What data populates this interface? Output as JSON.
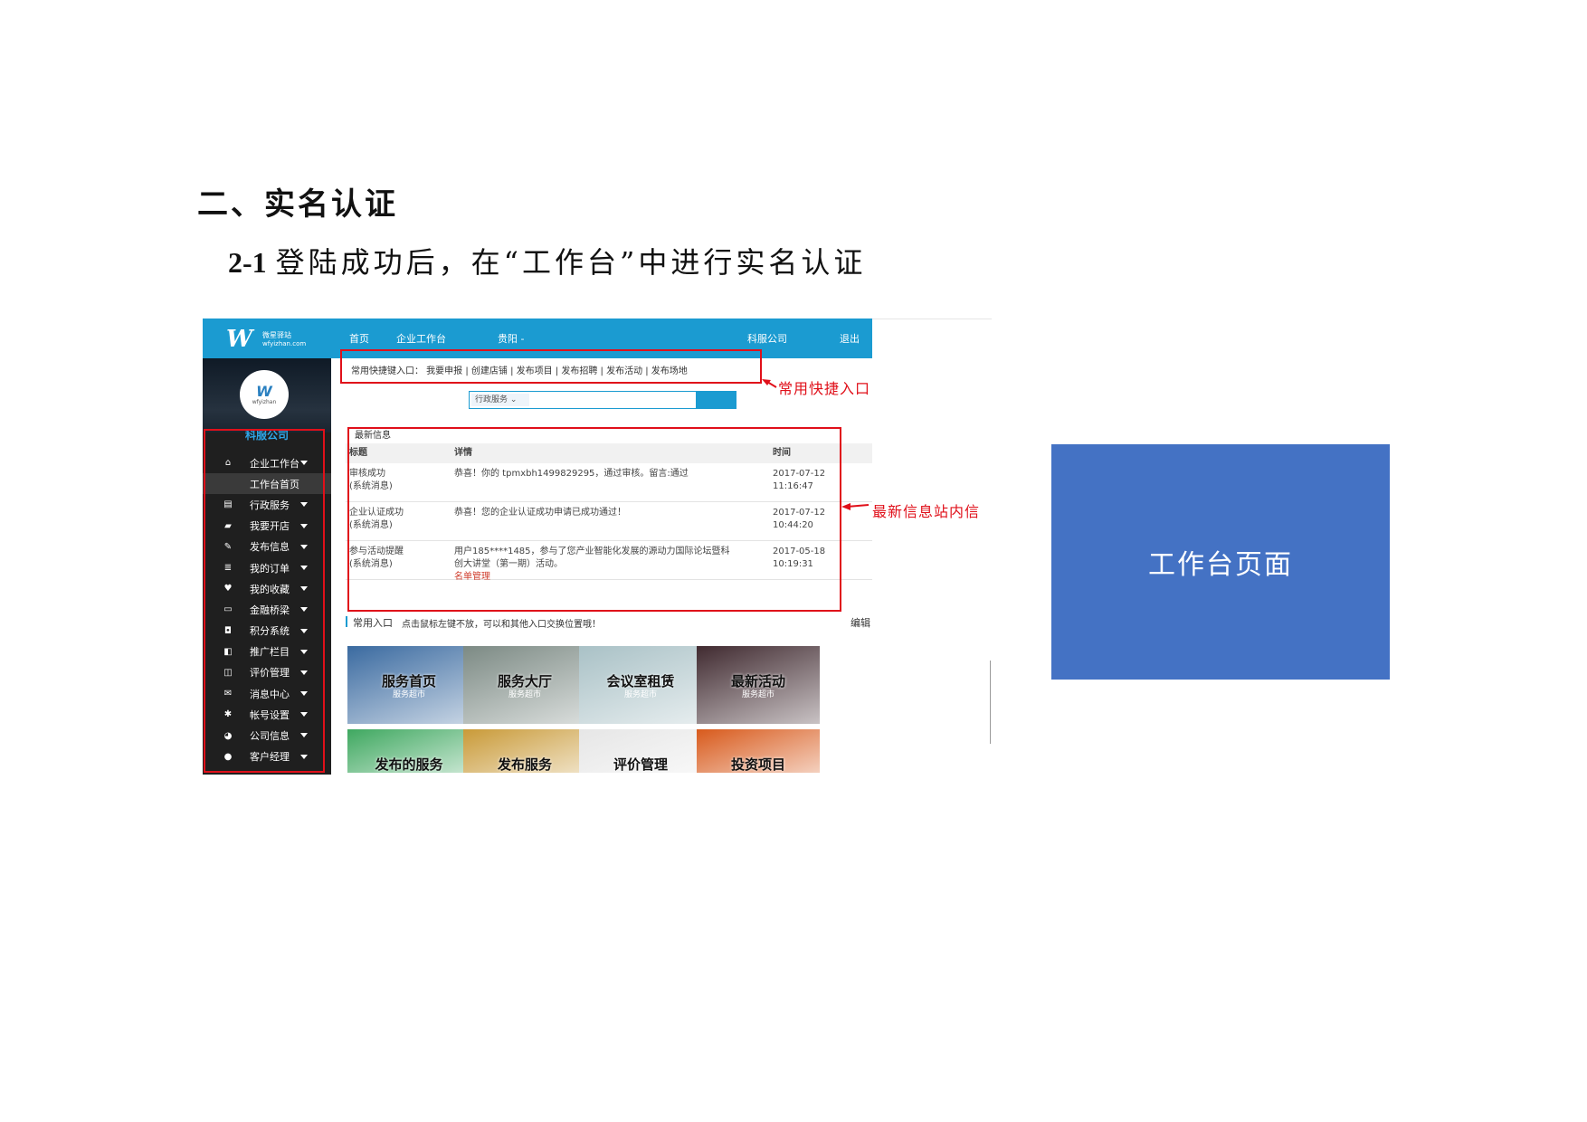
{
  "doc": {
    "heading": "二、实名认证",
    "step_num": "2-1",
    "step_text": "登陆成功后，在“工作台”中进行实名认证"
  },
  "topbar": {
    "logo_mark": "W",
    "logo_sub1": "微星驿站",
    "logo_sub2": "wfyizhan.com",
    "nav": [
      "首页",
      "企业工作台",
      "贵阳 -",
      "科服公司",
      "退出"
    ]
  },
  "sidebar": {
    "avatar_mark": "W",
    "avatar_text": "wfyizhan",
    "company": "科服公司",
    "items": [
      {
        "label": "企业工作台",
        "icon": "home-icon",
        "glyph": "⌂",
        "arrow": true
      },
      {
        "label": "工作台首页",
        "icon": "",
        "glyph": "",
        "arrow": false,
        "sub": true
      },
      {
        "label": "行政服务",
        "icon": "document-icon",
        "glyph": "▤",
        "arrow": true
      },
      {
        "label": "我要开店",
        "icon": "shop-icon",
        "glyph": "▰",
        "arrow": true
      },
      {
        "label": "发布信息",
        "icon": "pencil-icon",
        "glyph": "✎",
        "arrow": true
      },
      {
        "label": "我的订单",
        "icon": "list-icon",
        "glyph": "≣",
        "arrow": true
      },
      {
        "label": "我的收藏",
        "icon": "heart-icon",
        "glyph": "♥",
        "arrow": true
      },
      {
        "label": "金融桥梁",
        "icon": "card-icon",
        "glyph": "▭",
        "arrow": true
      },
      {
        "label": "积分系统",
        "icon": "gift-icon",
        "glyph": "◘",
        "arrow": true
      },
      {
        "label": "推广栏目",
        "icon": "promo-icon",
        "glyph": "◧",
        "arrow": true
      },
      {
        "label": "评价管理",
        "icon": "comment-icon",
        "glyph": "◫",
        "arrow": true
      },
      {
        "label": "消息中心",
        "icon": "mail-icon",
        "glyph": "✉",
        "arrow": true
      },
      {
        "label": "帐号设置",
        "icon": "gear-icon",
        "glyph": "✱",
        "arrow": true
      },
      {
        "label": "公司信息",
        "icon": "pie-icon",
        "glyph": "◕",
        "arrow": true
      },
      {
        "label": "客户经理",
        "icon": "user-icon",
        "glyph": "●",
        "arrow": true
      }
    ]
  },
  "quick": {
    "text": "常用快捷键入口： 我要申报 | 创建店铺 | 发布项目 | 发布招聘 | 发布活动 | 发布场地"
  },
  "search": {
    "select": "行政服务 ⌄"
  },
  "messages": {
    "title": "最新信息",
    "headers": [
      "标题",
      "详情",
      "时间"
    ],
    "rows": [
      {
        "title": "审核成功",
        "src": "(系统消息)",
        "detail": "恭喜！你的 tpmxbh1499829295，通过审核。留言:通过",
        "detail2": "",
        "link": "",
        "date": "2017-07-12",
        "time": "11:16:47"
      },
      {
        "title": "企业认证成功",
        "src": "(系统消息)",
        "detail": "恭喜！您的企业认证成功申请已成功通过！",
        "detail2": "",
        "link": "",
        "date": "2017-07-12",
        "time": "10:44:20"
      },
      {
        "title": "参与活动提醒",
        "src": "(系统消息)",
        "detail": "用户185****1485，参与了您产业智能化发展的源动力国际论坛暨科",
        "detail2": "创大讲堂（第一期）活动。",
        "link": "名单管理",
        "date": "2017-05-18",
        "time": "10:19:31"
      }
    ]
  },
  "common": {
    "title": "常用入口",
    "hint": "点击鼠标左键不放，可以和其他入口交换位置哦！",
    "edit": "编辑",
    "tiles": [
      {
        "title": "服务首页",
        "sub": "服务超市",
        "color": "#3a6aa0"
      },
      {
        "title": "服务大厅",
        "sub": "服务超市",
        "color": "#7c8a84"
      },
      {
        "title": "会议室租赁",
        "sub": "服务超市",
        "color": "#a9c1c6"
      },
      {
        "title": "最新活动",
        "sub": "服务超市",
        "color": "#402a30"
      },
      {
        "title": "发布的服务",
        "sub": "",
        "color": "#3fa860"
      },
      {
        "title": "发布服务",
        "sub": "",
        "color": "#c99a38"
      },
      {
        "title": "评价管理",
        "sub": "",
        "color": "#e6e6e6"
      },
      {
        "title": "投资项目",
        "sub": "",
        "color": "#d85a1c"
      }
    ]
  },
  "annotations": {
    "quick": "常用快捷入口",
    "latest": "最新信息站内信"
  },
  "panel": {
    "label": "工作台页面"
  },
  "colors": {
    "accent": "#1b9bd1",
    "annotation": "#e0101a",
    "panel": "#4472c4"
  }
}
